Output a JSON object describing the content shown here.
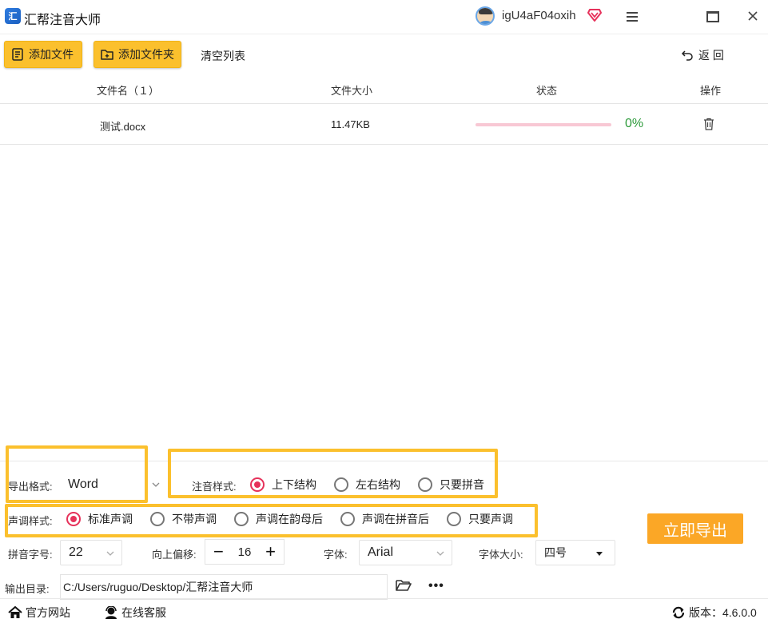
{
  "app": {
    "title": "汇帮注音大师",
    "logo_text": "汇",
    "username": "igU4aF04oxih"
  },
  "toolbar": {
    "add_file": "添加文件",
    "add_folder": "添加文件夹",
    "clear_list": "清空列表",
    "back": "返 回"
  },
  "table": {
    "headers": {
      "name": "文件名（１）",
      "size": "文件大小",
      "status": "状态",
      "action": "操作"
    },
    "rows": [
      {
        "name": "测试.docx",
        "size": "11.47KB",
        "progress": 0,
        "percent": "0%"
      }
    ]
  },
  "options": {
    "export_format_label": "导出格式:",
    "export_format_value": "Word",
    "annotation_style_label": "注音样式:",
    "annotation_styles": [
      "上下结构",
      "左右结构",
      "只要拼音"
    ],
    "annotation_selected": 0,
    "tone_style_label": "声调样式:",
    "tone_styles": [
      "标准声调",
      "不带声调",
      "声调在韵母后",
      "声调在拼音后",
      "只要声调"
    ],
    "tone_selected": 0,
    "pinyin_size_label": "拼音字号:",
    "pinyin_size_value": "22",
    "offset_label": "向上偏移:",
    "offset_value": "16",
    "offset_minus": "−",
    "offset_plus": "+",
    "font_label": "字体:",
    "font_value": "Arial",
    "font_size_label": "字体大小:",
    "font_size_value": "四号",
    "output_dir_label": "输出目录:",
    "output_dir_value": "C:/Users/ruguo/Desktop/汇帮注音大师",
    "more": "•••",
    "export_button": "立即导出"
  },
  "statusbar": {
    "website": "官方网站",
    "support": "在线客服",
    "version_label": "版本：",
    "version_value": "4.6.0.0"
  },
  "colors": {
    "accent_yellow": "#fbc02d",
    "export_orange": "#fba726",
    "radio_red": "#e6325b",
    "progress_pink": "#f8c8d4",
    "percent_green": "#2c9a3a"
  }
}
